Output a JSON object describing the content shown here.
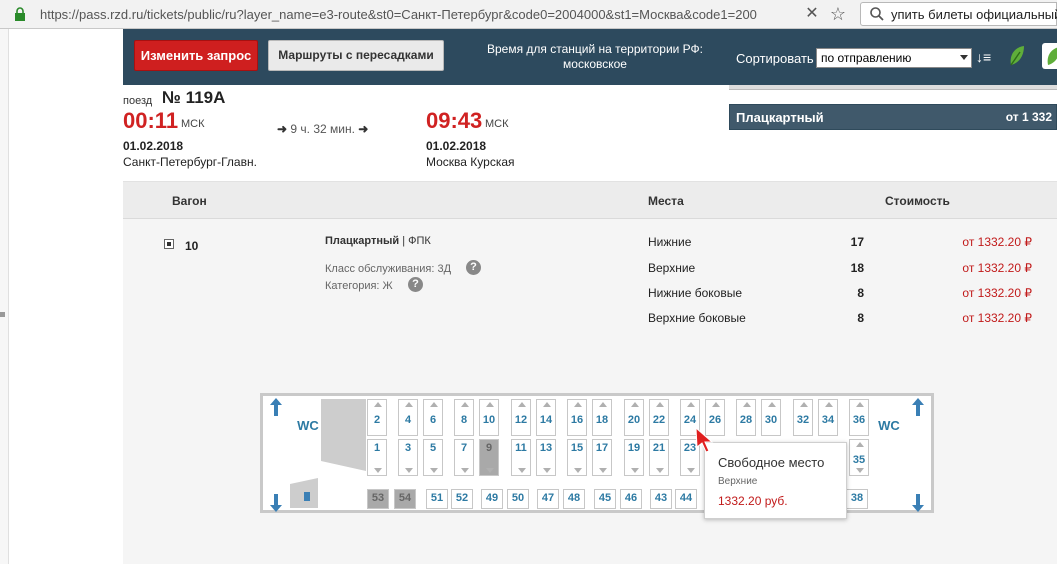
{
  "browser": {
    "url": "https://pass.rzd.ru/tickets/public/ru?layer_name=e3-route&st0=Санкт-Петербург&code0=2004000&st1=Москва&code1=200",
    "search_text": "упить билеты официальный"
  },
  "toolbar": {
    "edit_label": "Изменить запрос",
    "routes_label": "Маршруты с пересадками",
    "tz_note": "Время для станций на территории РФ: московское",
    "sort_label": "Сортировать",
    "sort_value": "по отправлению"
  },
  "train": {
    "label": "поезд",
    "number": "№ 119А",
    "depart_time": "00:11",
    "depart_tz": "МСК",
    "depart_date": "01.02.2018",
    "depart_station": "Санкт-Петербург-Главн.",
    "duration": "9 ч. 32 мин.",
    "arrive_time": "09:43",
    "arrive_tz": "МСК",
    "arrive_date": "01.02.2018",
    "arrive_station": "Москва Курская"
  },
  "fare_card": {
    "name": "Плацкартный",
    "price": "от 1 332"
  },
  "table": {
    "headers": {
      "car": "Вагон",
      "seats": "Места",
      "cost": "Стоимость"
    },
    "car_number": "10",
    "car_type": "Плацкартный",
    "carrier": "ФПК",
    "service_class": "Класс обслуживания: 3Д",
    "category": "Категория: Ж",
    "help": "?",
    "rows": [
      {
        "type": "Нижние",
        "count": "17",
        "price": "от 1332.20 ₽"
      },
      {
        "type": "Верхние",
        "count": "18",
        "price": "от 1332.20 ₽"
      },
      {
        "type": "Нижние боковые",
        "count": "8",
        "price": "от 1332.20 ₽"
      },
      {
        "type": "Верхние боковые",
        "count": "8",
        "price": "от 1332.20 ₽"
      }
    ]
  },
  "diagram": {
    "wc_label": "WC",
    "top_seats": [
      "2",
      "4",
      "6",
      "8",
      "10",
      "12",
      "14",
      "16",
      "18",
      "20",
      "22",
      "24",
      "26",
      "28",
      "30",
      "32",
      "34",
      "36"
    ],
    "bottom_seats": [
      "1",
      "3",
      "5",
      "7",
      "9",
      "11",
      "13",
      "15",
      "17",
      "19",
      "21",
      "23"
    ],
    "occupied_bottom": [
      "9"
    ],
    "side_seats": [
      "53",
      "54",
      "51",
      "52",
      "49",
      "50",
      "47",
      "48",
      "45",
      "46",
      "43",
      "44",
      "38"
    ],
    "occupied_side": [
      "53",
      "54"
    ],
    "right_bottom_seat": "35"
  },
  "tooltip": {
    "title": "Свободное место",
    "subtitle": "Верхние",
    "price": "1332.20 руб."
  },
  "colors": {
    "toolbar_bg": "#2d4a5e",
    "accent_red": "#cf1f1f",
    "price_red": "#c11a1a",
    "seat_blue": "#2d7aa3"
  }
}
